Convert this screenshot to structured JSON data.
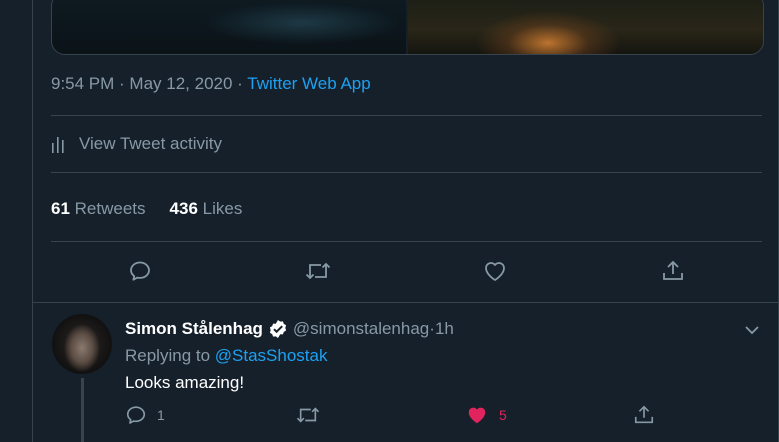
{
  "tweet": {
    "time": "9:54 PM",
    "date": "May 12, 2020",
    "separator": " · ",
    "source": "Twitter Web App",
    "activity_label": "View Tweet activity",
    "retweets_count": "61",
    "retweets_label": "Retweets",
    "likes_count": "436",
    "likes_label": "Likes"
  },
  "reply": {
    "name": "Simon Stålenhag",
    "handle": "@simonstalenhag",
    "time_sep": " · ",
    "time": "1h",
    "replying_prefix": "Replying to ",
    "replying_to": "@StasShostak",
    "text": "Looks amazing!",
    "reply_count": "1",
    "retweet_count": "",
    "like_count": "5",
    "liked": true
  },
  "icons": {
    "reply": "comment-bubble-icon",
    "retweet": "retweet-icon",
    "like": "heart-icon",
    "share": "share-icon",
    "activity": "bar-chart-icon",
    "verified": "verified-badge-icon",
    "more": "chevron-down-icon"
  },
  "colors": {
    "background": "#15202b",
    "border": "#38444d",
    "secondary_text": "#8899a6",
    "link": "#1da1f2",
    "like": "#e0245e"
  }
}
